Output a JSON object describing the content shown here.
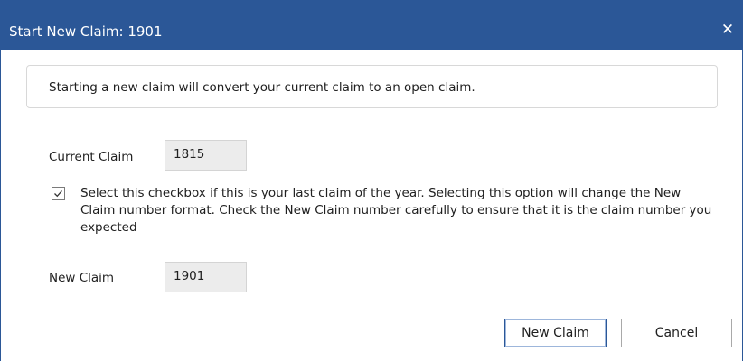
{
  "window": {
    "title": "Start New Claim: 1901",
    "close_glyph": "✕",
    "titlebar_color": "#2b5797"
  },
  "info": {
    "message": "Starting a new claim will convert your current claim to an open claim."
  },
  "current_claim": {
    "label": "Current Claim",
    "value": "1815"
  },
  "last_claim_checkbox": {
    "checked": true,
    "text": "Select this checkbox if this is your last claim of the year. Selecting this option will change the New Claim number format. Check the New Claim number carefully to ensure that it is the claim number you expected"
  },
  "new_claim": {
    "label": "New Claim",
    "value": "1901"
  },
  "buttons": {
    "primary_label_first": "N",
    "primary_label_rest": "ew Claim",
    "cancel_label": "Cancel"
  }
}
